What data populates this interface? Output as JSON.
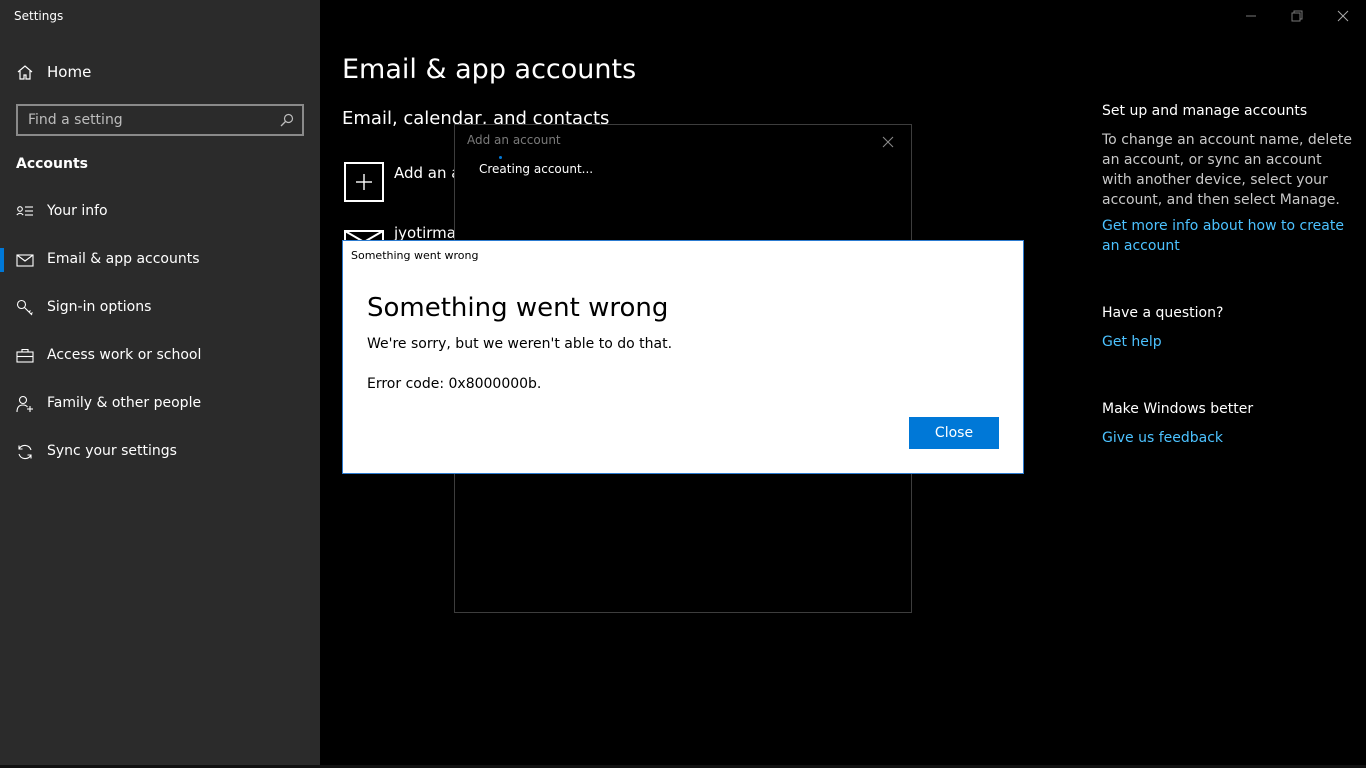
{
  "window": {
    "app_title": "Settings"
  },
  "sidebar": {
    "home_label": "Home",
    "search_placeholder": "Find a setting",
    "section_title": "Accounts",
    "items": [
      {
        "label": "Your info",
        "icon": "person-card-icon"
      },
      {
        "label": "Email & app accounts",
        "icon": "mail-icon",
        "selected": true
      },
      {
        "label": "Sign-in options",
        "icon": "key-icon"
      },
      {
        "label": "Access work or school",
        "icon": "briefcase-icon"
      },
      {
        "label": "Family & other people",
        "icon": "person-add-icon"
      },
      {
        "label": "Sync your settings",
        "icon": "sync-icon"
      }
    ]
  },
  "main": {
    "page_title": "Email & app accounts",
    "section_title": "Email, calendar, and contacts",
    "add_account_label": "Add an a",
    "account_label": "jyotirmay"
  },
  "right_panel": {
    "manage_heading": "Set up and manage accounts",
    "manage_text": "To change an account name, delete an account, or sync an account with another device, select your account, and then select Manage.",
    "manage_link": "Get more info about how to create an account",
    "question_heading": "Have a question?",
    "question_link": "Get help",
    "better_heading": "Make Windows better",
    "better_link": "Give us feedback"
  },
  "add_account_dialog": {
    "title": "Add an account",
    "status": "Creating account..."
  },
  "error_dialog": {
    "window_title": "Something went wrong",
    "heading": "Something went wrong",
    "message": "We're sorry, but we weren't able to do that.",
    "error_code": "Error code: 0x8000000b.",
    "close_label": "Close"
  },
  "colors": {
    "accent": "#0078d7",
    "link": "#4cc2ff",
    "sidebar_bg": "#2b2b2b"
  }
}
